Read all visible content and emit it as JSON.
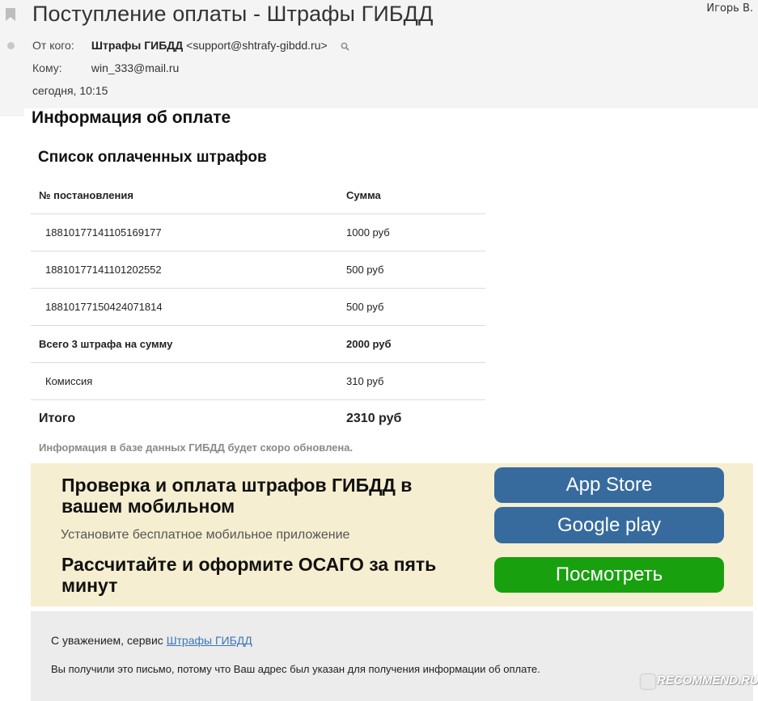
{
  "email": {
    "subject": "Поступление оплаты - Штрафы ГИБДД",
    "user_name": "Игорь В.",
    "from_label": "От кого:",
    "from_name": "Штрафы ГИБДД",
    "from_email": "<support@shtrafy-gibdd.ru>",
    "to_label": "Кому:",
    "to_email": "win_333@mail.ru",
    "date": "сегодня, 10:15"
  },
  "body": {
    "title": "Информация об оплате",
    "list_title": "Список оплаченных штрафов",
    "table": {
      "headers": [
        "№ постановления",
        "Сумма"
      ],
      "rows": [
        {
          "number": "18810177141105169177",
          "amount": "1000 руб"
        },
        {
          "number": "18810177141101202552",
          "amount": "500 руб"
        },
        {
          "number": "18810177150424071814",
          "amount": "500 руб"
        }
      ],
      "subtotal_label": "Всего 3 штрафа на сумму",
      "subtotal_value": "2000 руб",
      "commission_label": "Комиссия",
      "commission_value": "310 руб",
      "total_label": "Итого",
      "total_value": "2310 руб"
    },
    "note": "Информация в базе данных ГИБДД будет скоро обновлена."
  },
  "promo": {
    "heading1": "Проверка и оплата штрафов ГИБДД в вашем мобильном",
    "subtitle": "Установите бесплатное мобильное приложение",
    "heading2": "Рассчитайте и оформите ОСАГО за пять минут",
    "app_store_label": "App Store",
    "google_play_label": "Google play",
    "view_label": "Посмотреть",
    "colors": {
      "blue": "#376b9e",
      "green": "#18a00e",
      "background": "#f6eed0"
    }
  },
  "footer": {
    "regards_text": "С уважением, сервис ",
    "regards_link": "Штрафы ГИБДД",
    "disclaimer": "Вы получили это письмо, потому что Ваш адрес был указан для получения информации об оплате."
  },
  "watermark": "RECOMMEND.RU"
}
